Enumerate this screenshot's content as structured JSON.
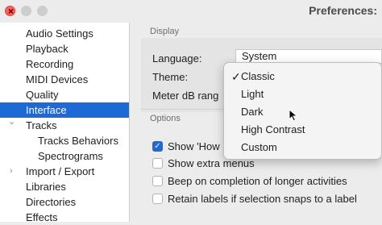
{
  "window": {
    "title": "Preferences:",
    "close_glyph": "×"
  },
  "sidebar": {
    "items": [
      {
        "label": "Audio Settings"
      },
      {
        "label": "Playback"
      },
      {
        "label": "Recording"
      },
      {
        "label": "MIDI Devices"
      },
      {
        "label": "Quality"
      },
      {
        "label": "Interface",
        "selected": true
      },
      {
        "label": "Tracks",
        "expanded": true
      },
      {
        "label": "Tracks Behaviors"
      },
      {
        "label": "Spectrograms"
      },
      {
        "label": "Import / Export",
        "expanded": false
      },
      {
        "label": "Libraries"
      },
      {
        "label": "Directories"
      },
      {
        "label": "Effects"
      }
    ],
    "chevron_down": "⌄",
    "chevron_right": "›"
  },
  "display": {
    "section_label": "Display",
    "language_label": "Language:",
    "language_value": "System",
    "theme_label": "Theme:",
    "meter_label": "Meter dB rang"
  },
  "options": {
    "section_label": "Options",
    "items": [
      {
        "label": "Show 'How",
        "checked": true
      },
      {
        "label": "Show extra menus",
        "checked": false
      },
      {
        "label": "Beep on completion of longer activities",
        "checked": false
      },
      {
        "label": "Retain labels if selection snaps to a label",
        "checked": false
      }
    ],
    "check_glyph": "✓"
  },
  "theme_dropdown": {
    "selected_glyph": "✓",
    "options": [
      "Classic",
      "Light",
      "Dark",
      "High Contrast",
      "Custom"
    ],
    "selected_index": 0
  },
  "colors": {
    "selection": "#1d69d6",
    "close_button": "#ff5f57"
  }
}
